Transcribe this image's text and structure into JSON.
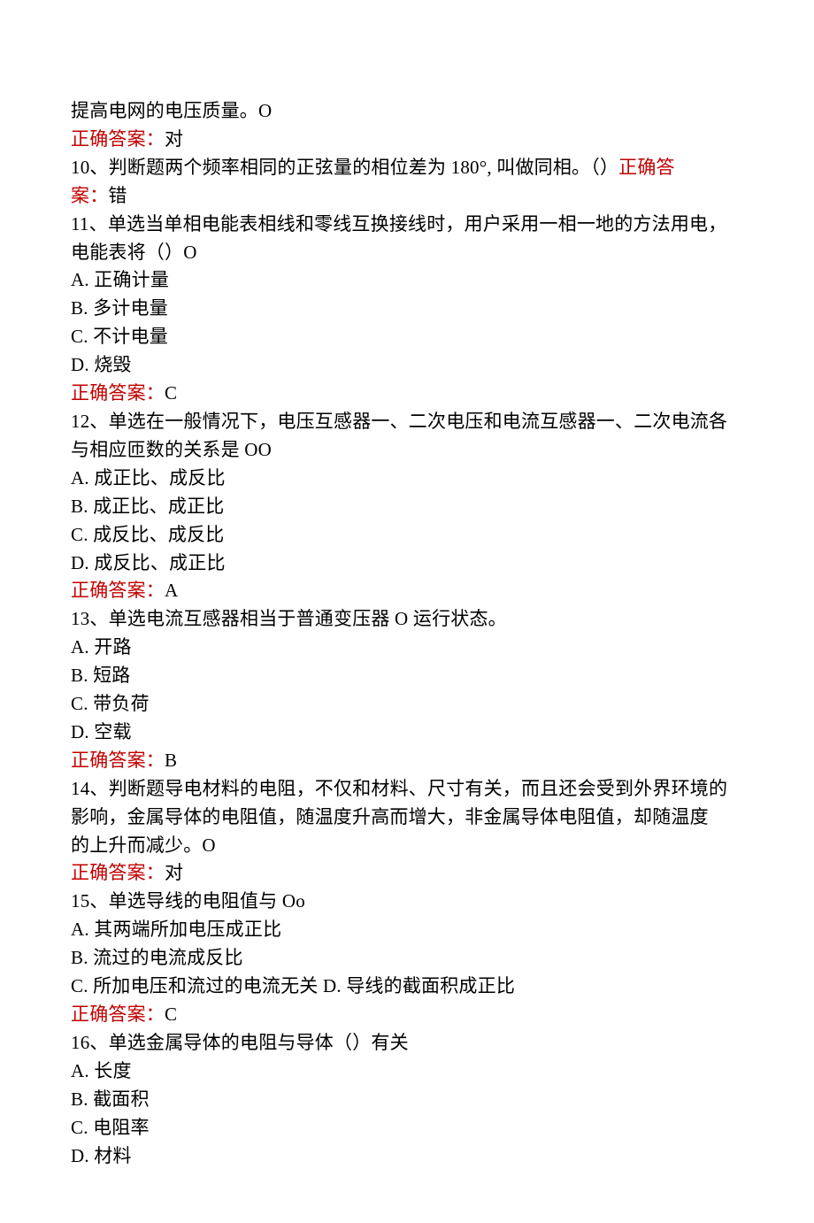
{
  "lines": {
    "q9_tail": "提高电网的电压质量。O",
    "ans_prefix": "正确答案：",
    "q9_ans": "对",
    "q10_a": "10、判断题两个频率相同的正弦量的相位差为 180°, 叫做同相。（）",
    "q10_ans_prefix": "正确答",
    "q10_ans_prefix2": "案：",
    "q10_ans": "错",
    "q11_a": "11、单选当单相电能表相线和零线互换接线时，用户采用一相一地的方法用电，",
    "q11_b": "电能表将（）O",
    "q11_optA": "A. 正确计量",
    "q11_optB": "B. 多计电量",
    "q11_optC": "C. 不计电量",
    "q11_optD": "D. 烧毁",
    "q11_ans": "C",
    "q12_a": "12、单选在一般情况下，电压互感器一、二次电压和电流互感器一、二次电流各",
    "q12_b": "与相应匝数的关系是 OO",
    "q12_optA": "A. 成正比、成反比",
    "q12_optB": "B. 成正比、成正比",
    "q12_optC": "C. 成反比、成反比",
    "q12_optD": "D. 成反比、成正比",
    "q12_ans": "A",
    "q13_a": "13、单选电流互感器相当于普通变压器 O 运行状态。",
    "q13_optA": "A. 开路",
    "q13_optB": "B. 短路",
    "q13_optC": "C. 带负荷",
    "q13_optD": "D. 空载",
    "q13_ans": "B",
    "q14_a": "14、判断题导电材料的电阻，不仅和材料、尺寸有关，而且还会受到外界环境的",
    "q14_b": "影响，金属导体的电阻值，随温度升高而增大，非金属导体电阻值，却随温度",
    "q14_c": "的上升而减少。O",
    "q14_ans": "对",
    "q15_a": "15、单选导线的电阻值与 Oo",
    "q15_optA": "A. 其两端所加电压成正比",
    "q15_optB": "B. 流过的电流成反比",
    "q15_optC": "C. 所加电压和流过的电流无关 D. 导线的截面积成正比",
    "q15_ans": "C",
    "q16_a": "16、单选金属导体的电阻与导体（）有关",
    "q16_optA": "A. 长度",
    "q16_optB": "B. 截面积",
    "q16_optC": "C. 电阻率",
    "q16_optD": "D. 材料"
  }
}
